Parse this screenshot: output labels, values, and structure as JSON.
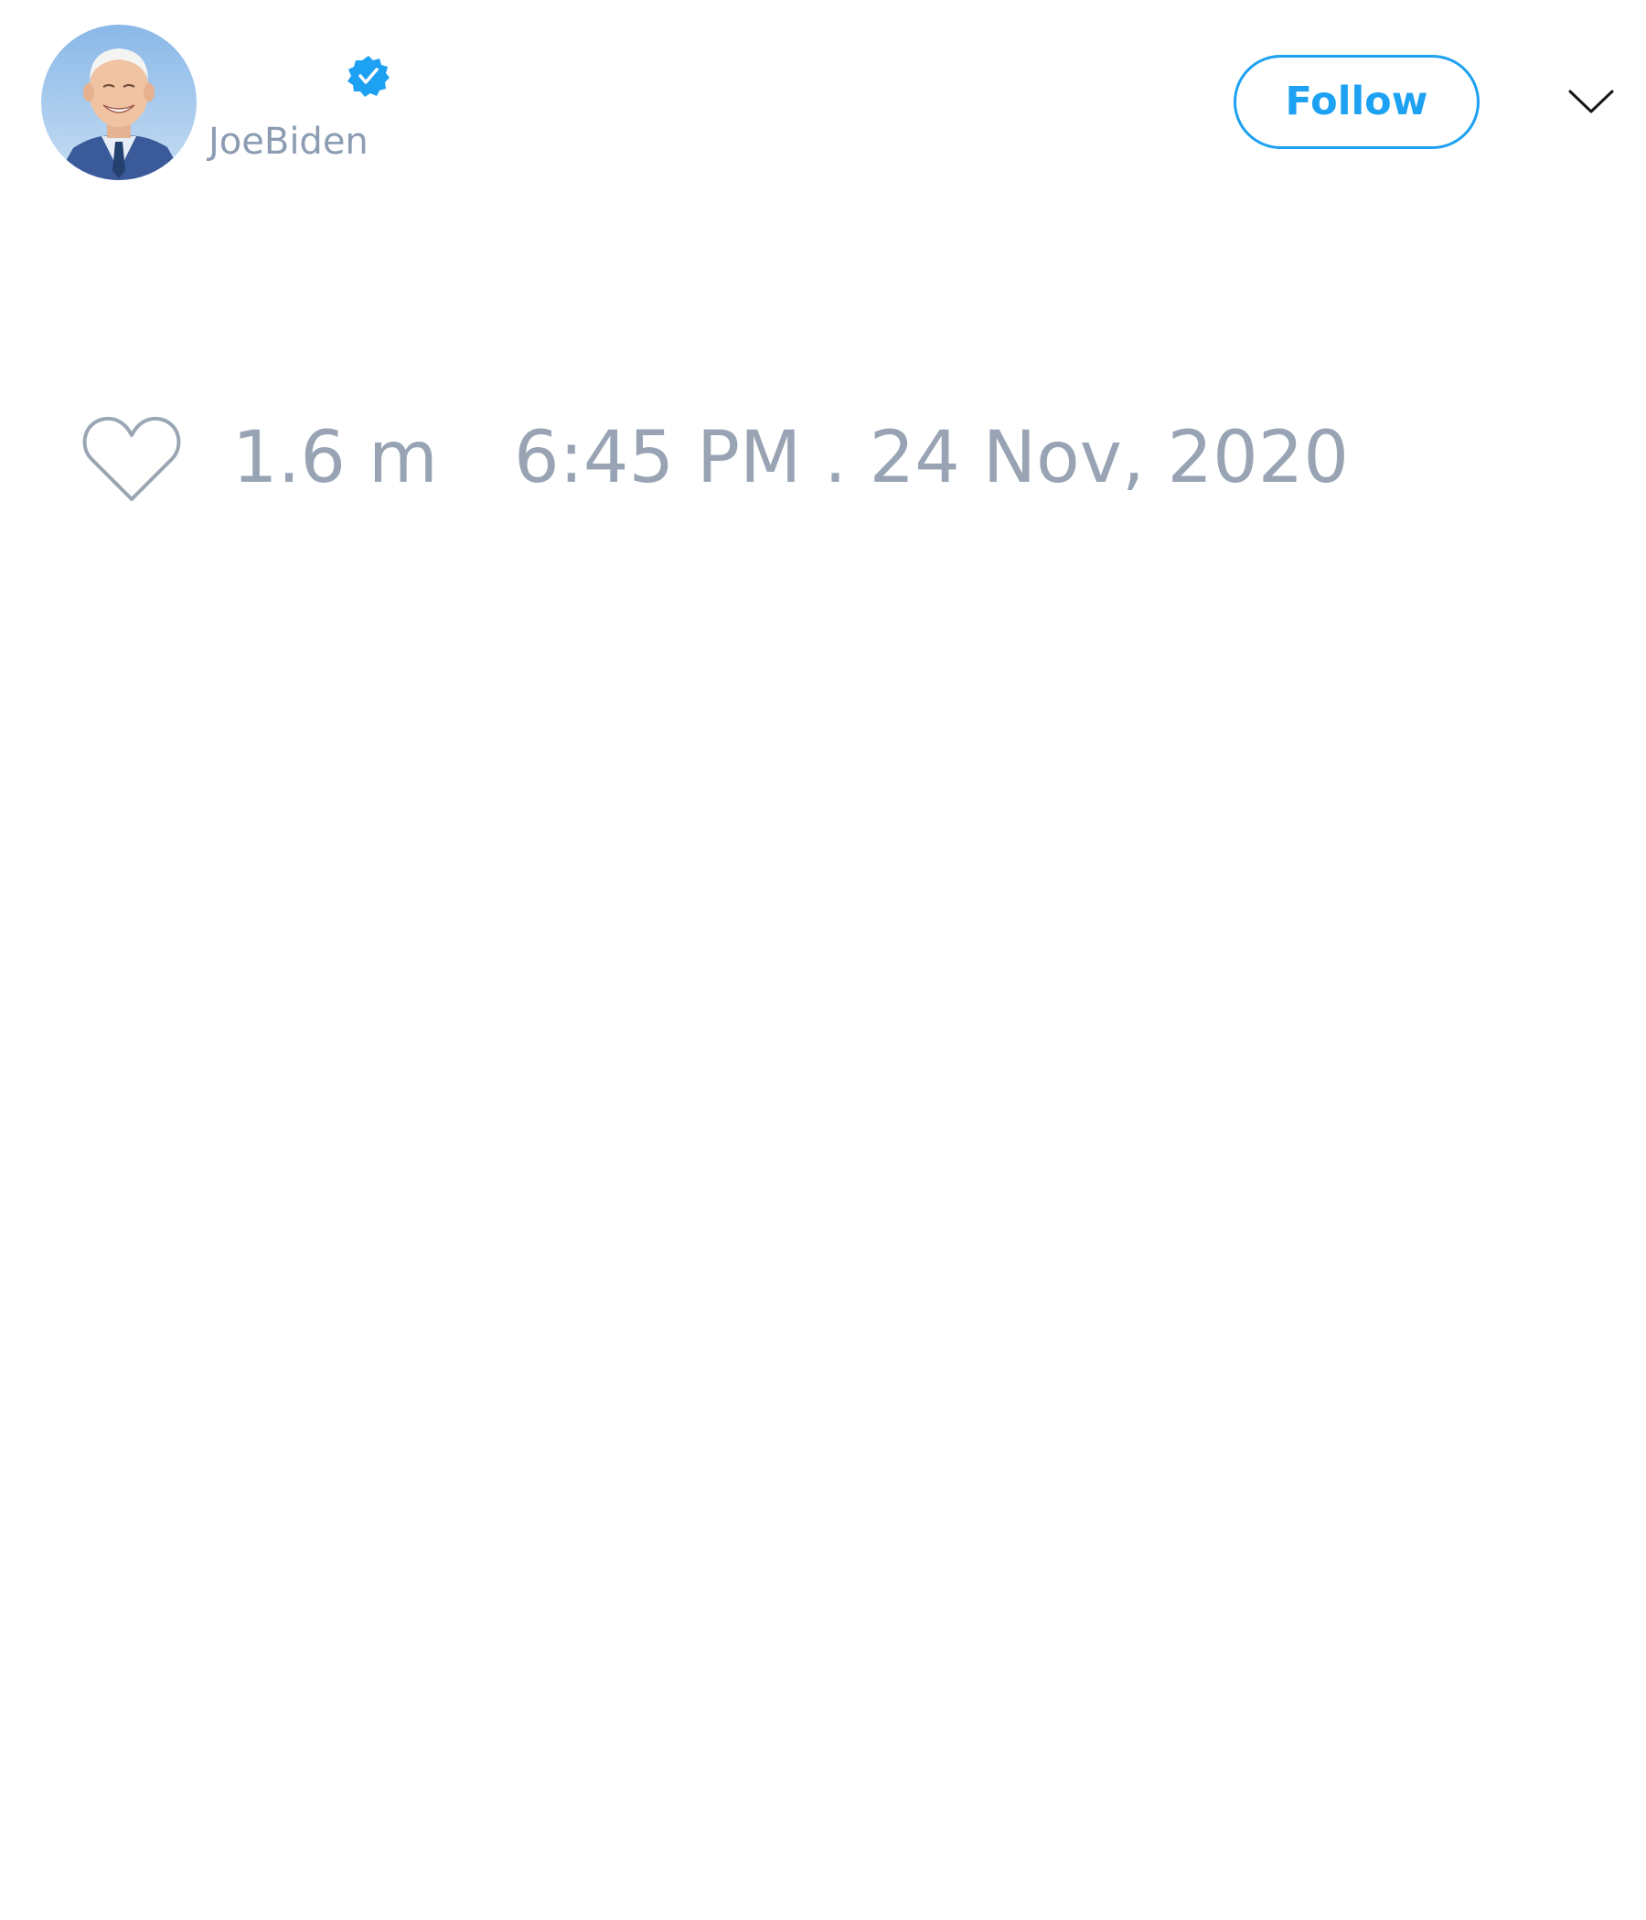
{
  "tweet": {
    "author": {
      "display_name": "",
      "handle": "JoeBiden",
      "verified": true,
      "avatar": "avatar-photo"
    },
    "follow_label": "Follow",
    "menu_icon": "chevron-down-icon",
    "like_icon": "heart-icon",
    "like_count": "1.6 m",
    "timestamp": "6:45 PM . 24 Nov, 2020"
  },
  "colors": {
    "accent": "#1da1f2",
    "muted_text": "#98a4b4",
    "handle_text": "#8c9cb2",
    "icon_stroke": "#9aa6b4",
    "background": "#ffffff"
  }
}
